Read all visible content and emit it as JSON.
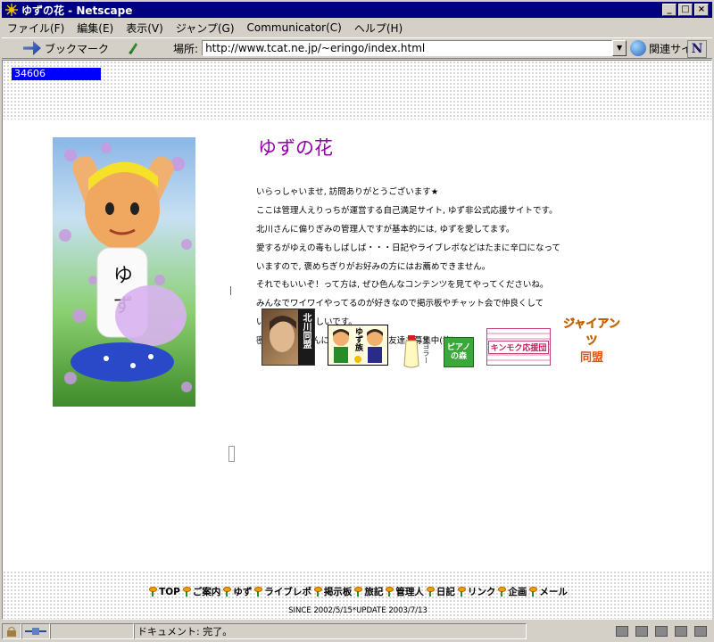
{
  "window": {
    "title": "ゆずの花 - Netscape",
    "controls": [
      "_",
      "□",
      "×"
    ]
  },
  "menu": [
    "ファイル(F)",
    "編集(E)",
    "表示(V)",
    "ジャンプ(G)",
    "Communicator(C)",
    "ヘルプ(H)"
  ],
  "toolbar": {
    "bookmark_label": "ブックマーク",
    "location_label": "場所:",
    "url": "http://www.tcat.ne.jp/~eringo/index.html",
    "related_label": "関連サイト",
    "logo": "N"
  },
  "page": {
    "counter": "34606",
    "title": "ゆずの花",
    "photo_label": "ゆず",
    "intro_lines": [
      "いらっしゃいませ, 訪問ありがとうございます★",
      "ここは管理人えりっちが運営する自己満足サイト, ゆず非公式応援サイトです。",
      "北川さんに偏りぎみの管理人ですが基本的には, ゆずを愛してます。",
      "愛するがゆえの毒もしばしば・・・日記やライブレポなどはたまに辛口になって",
      "いますので, 褒めちぎりがお好みの方にはお薦めできません。",
      "それでもいいぞ！って方は, ぜひ色んなコンテンツを見てやってくださいね。",
      "みんなでワイワイやってるのが好きなので掲示板やチャット会で仲良くして",
      "いただけたら嬉しいです。",
      "密かに, 北川さんについて語れるお友達も募集中(笑)"
    ],
    "banners": {
      "kitagawa": "北川同盟",
      "yuzu_kids": "ゆず族",
      "mayo": "マヨラー",
      "piano": "ピアノの森",
      "kimomoku": "キンモク応援団",
      "giants": [
        "ジャイアンツ",
        "同盟"
      ]
    },
    "nav": [
      "TOP",
      "ご案内",
      "ゆず",
      "ライブレポ",
      "掲示板",
      "旅記",
      "管理人",
      "日記",
      "リンク",
      "企画",
      "メール"
    ],
    "since": "SINCE 2002/5/15*UPDATE 2003/7/13"
  },
  "status": {
    "text": "ドキュメント: 完了。"
  }
}
